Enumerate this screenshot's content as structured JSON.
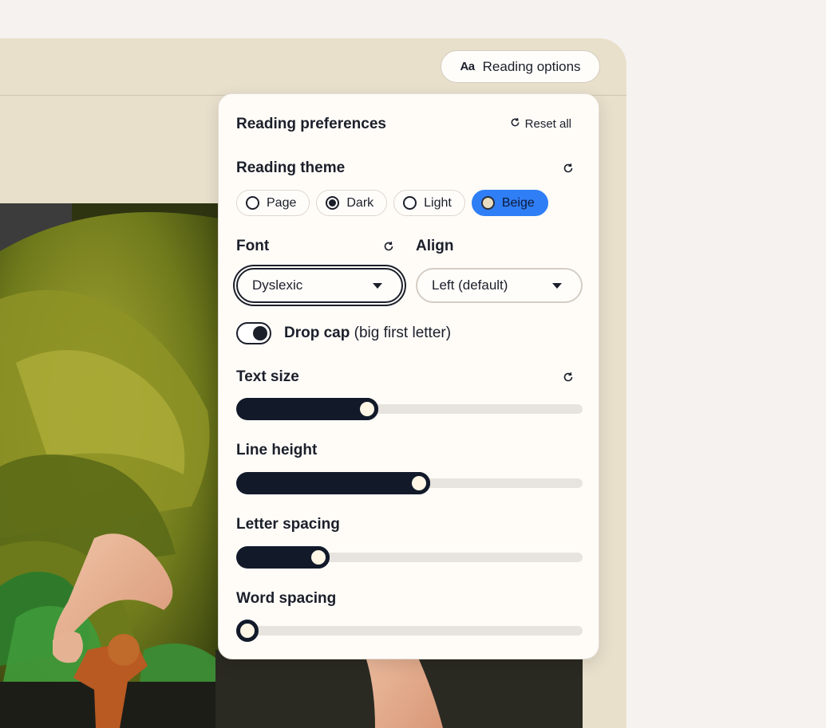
{
  "toolbar": {
    "reading_options_icon": "Aa",
    "reading_options_label": "Reading options"
  },
  "panel": {
    "title": "Reading preferences",
    "reset_all_label": "Reset all",
    "theme": {
      "label": "Reading theme",
      "options": [
        {
          "label": "Page",
          "selected": false
        },
        {
          "label": "Dark",
          "selected": false
        },
        {
          "label": "Light",
          "selected": false
        },
        {
          "label": "Beige",
          "selected": true
        }
      ]
    },
    "font": {
      "label": "Font",
      "value": "Dyslexic"
    },
    "align": {
      "label": "Align",
      "value": "Left (default)"
    },
    "drop_cap": {
      "label_bold": "Drop cap",
      "label_rest": " (big first letter)",
      "enabled": true
    },
    "sliders": [
      {
        "label": "Text size",
        "fraction": 0.37
      },
      {
        "label": "Line height",
        "fraction": 0.53
      },
      {
        "label": "Letter spacing",
        "fraction": 0.22
      },
      {
        "label": "Word spacing",
        "fraction": 0.0
      }
    ]
  },
  "colors": {
    "accent": "#2f7ef6",
    "ink": "#121a2a",
    "beige": "#e8e0cb"
  }
}
